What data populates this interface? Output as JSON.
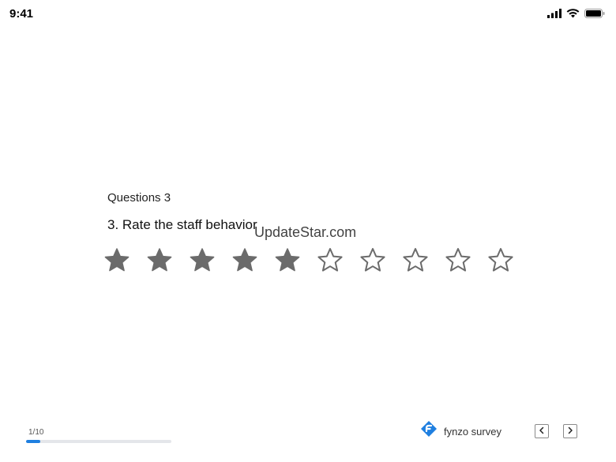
{
  "status_bar": {
    "time": "9:41",
    "icons": [
      "signal-icon",
      "wifi-icon",
      "battery-icon"
    ]
  },
  "question": {
    "number_label": "Questions 3",
    "text": "3. Rate the staff behavior"
  },
  "watermark": "UpdateStar.com",
  "rating": {
    "max": 10,
    "value": 5,
    "filled_color": "#6b6b6b",
    "empty_stroke_color": "#6b6b6b"
  },
  "progress": {
    "label": "1/10",
    "fraction": 0.1,
    "color": "#1f7fe0"
  },
  "brand": {
    "name": "fynzo survey",
    "icon": "fynzo-logo-icon",
    "color": "#1f7fe0"
  },
  "navigation": {
    "prev_icon": "chevron-left-icon",
    "next_icon": "chevron-right-icon"
  }
}
